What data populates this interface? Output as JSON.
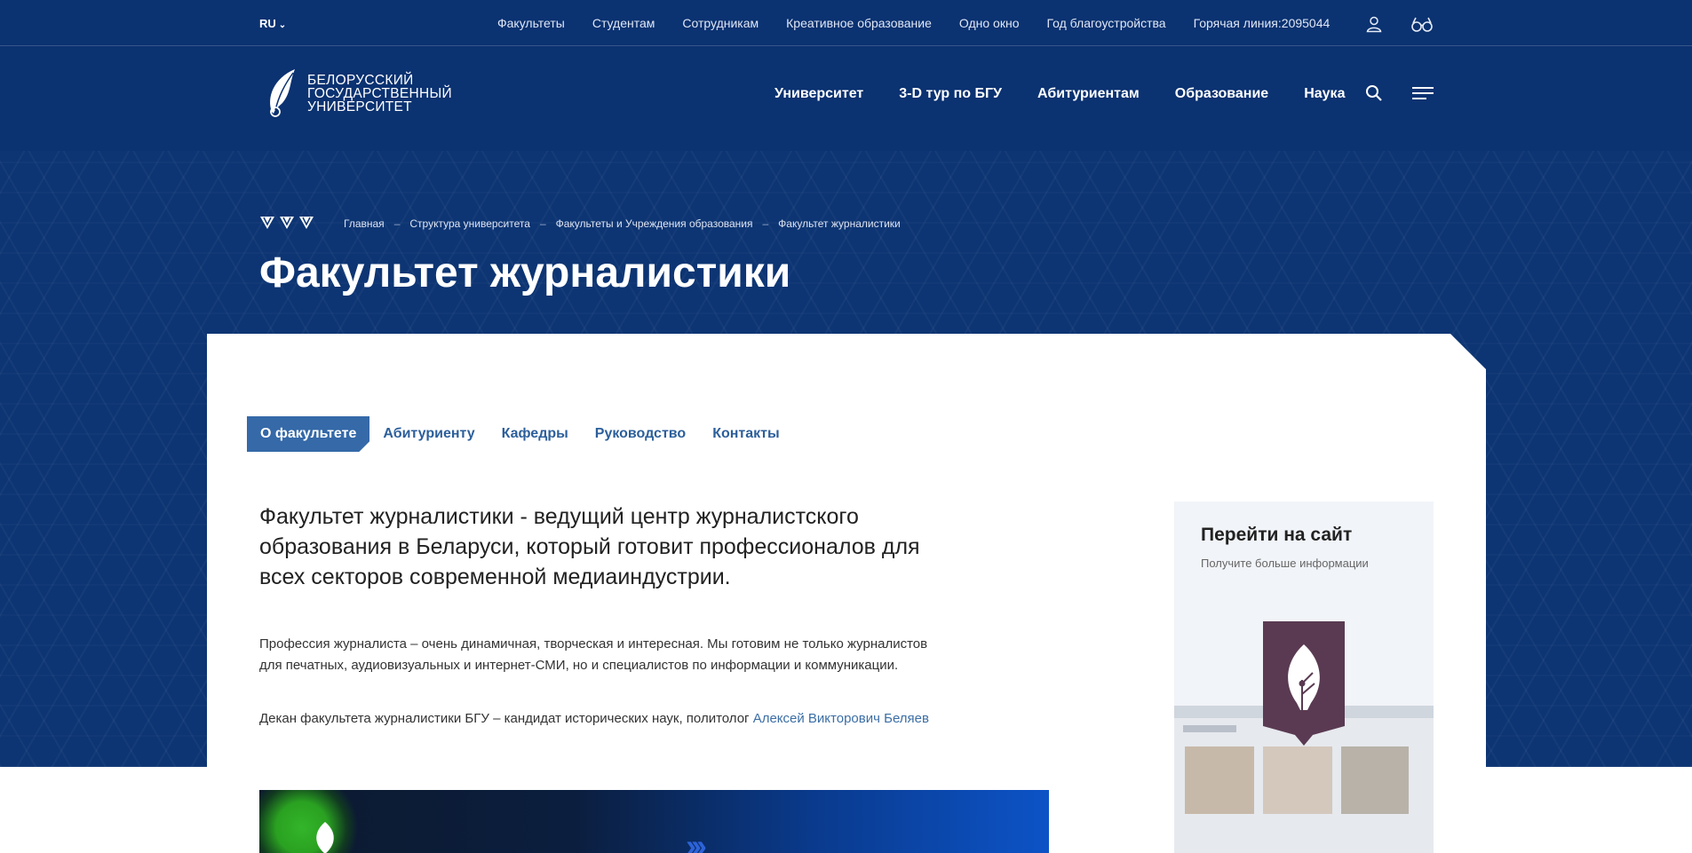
{
  "topbar": {
    "lang": "RU",
    "links": [
      "Факультеты",
      "Студентам",
      "Сотрудникам",
      "Креативное образование",
      "Одно окно",
      "Год благоустройства",
      "Горячая линия:2095044"
    ]
  },
  "logo": {
    "lines": [
      "БЕЛОРУССКИЙ",
      "ГОСУДАРСТВЕННЫЙ",
      "УНИВЕРСИТЕТ"
    ]
  },
  "mainnav": [
    "Университет",
    "3-D тур по БГУ",
    "Абитуриентам",
    "Образование",
    "Наука"
  ],
  "breadcrumb": [
    "Главная",
    "Структура университета",
    "Факультеты и Учреждения образования",
    "Факультет журналистики"
  ],
  "breadcrumb_separator": "–",
  "page_title": "Факультет журналистики",
  "tabs": [
    {
      "label": "О факультете",
      "active": true
    },
    {
      "label": "Абитуриенту",
      "active": false
    },
    {
      "label": "Кафедры",
      "active": false
    },
    {
      "label": "Руководство",
      "active": false
    },
    {
      "label": "Контакты",
      "active": false
    }
  ],
  "content": {
    "lead": "Факультет журналистики - ведущий центр журналистского образования в Беларуси, который готовит профессионалов для всех секторов современной медиаиндустрии.",
    "para1": "Профессия журналиста – очень динамичная, творческая и интересная. Мы готовим не только журналистов для печатных, аудиовизуальных и интернет-СМИ, но и специалистов по информации и коммуникации.",
    "para2_text": "Декан факультета журналистики БГУ – кандидат исторических наук, политолог ",
    "para2_link": "Алексей Викторович Беляев"
  },
  "sidebar": {
    "title": "Перейти на сайт",
    "subtitle": "Получите больше информации"
  },
  "colors": {
    "hero_bg": "#0d3573",
    "tab_active": "#3569a8",
    "link": "#3b6ea5",
    "emblem": "#5a3a52"
  },
  "icons": [
    "chevron-down-icon",
    "user-icon",
    "glasses-icon",
    "search-icon",
    "menu-icon",
    "quill-logo-icon",
    "bsu-mark-icon",
    "faculty-emblem-icon"
  ]
}
